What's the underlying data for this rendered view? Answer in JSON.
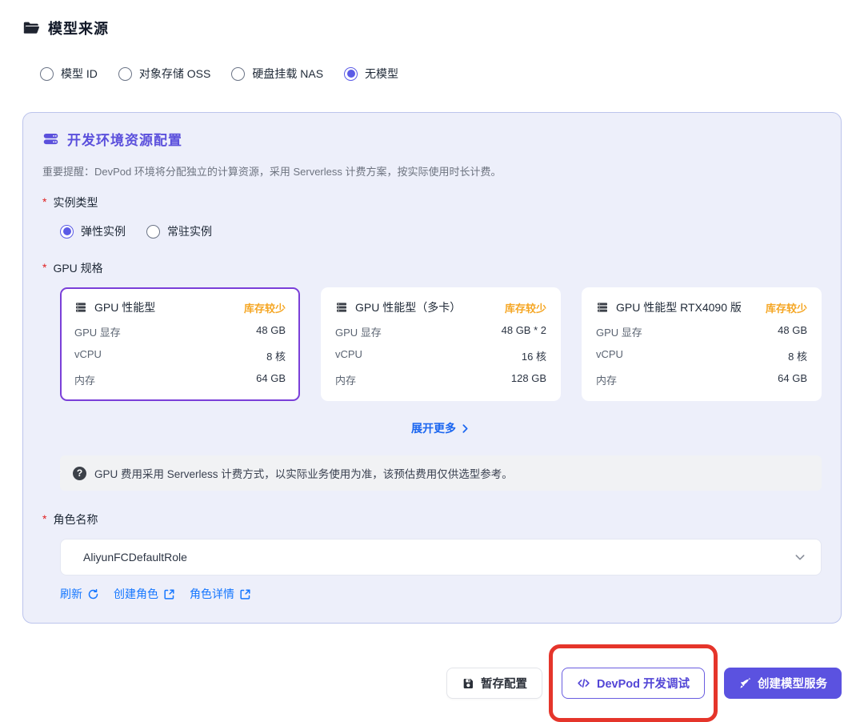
{
  "colors": {
    "primary_purple": "#5b52e0",
    "selected_border_purple": "#7a3fd8",
    "link_blue": "#1677ff",
    "expand_blue": "#1b66f0",
    "badge_orange": "#f5a623",
    "annotation_red": "#e5352b",
    "panel_bg": "#edeffa",
    "required_red": "#e02020"
  },
  "header": {
    "title": "模型来源"
  },
  "model_source": {
    "options": [
      {
        "label": "模型 ID",
        "selected": false
      },
      {
        "label": "对象存储 OSS",
        "selected": false
      },
      {
        "label": "硬盘挂载 NAS",
        "selected": false
      },
      {
        "label": "无模型",
        "selected": true
      }
    ]
  },
  "panel": {
    "title": "开发环境资源配置",
    "notice": "重要提醒：DevPod 环境将分配独立的计算资源，采用 Serverless 计费方案，按实际使用时长计费。",
    "instance_type": {
      "label": "实例类型",
      "options": [
        {
          "label": "弹性实例",
          "selected": true
        },
        {
          "label": "常驻实例",
          "selected": false
        }
      ]
    },
    "gpu_spec": {
      "label": "GPU 规格",
      "cards": [
        {
          "name": "GPU 性能型",
          "badge": "库存较少",
          "selected": true,
          "specs": [
            {
              "label": "GPU 显存",
              "value": "48 GB"
            },
            {
              "label": "vCPU",
              "value": "8 核"
            },
            {
              "label": "内存",
              "value": "64 GB"
            }
          ]
        },
        {
          "name": "GPU 性能型（多卡）",
          "badge": "库存较少",
          "selected": false,
          "specs": [
            {
              "label": "GPU 显存",
              "value": "48 GB * 2"
            },
            {
              "label": "vCPU",
              "value": "16 核"
            },
            {
              "label": "内存",
              "value": "128 GB"
            }
          ]
        },
        {
          "name": "GPU 性能型 RTX4090 版",
          "badge": "库存较少",
          "selected": false,
          "specs": [
            {
              "label": "GPU 显存",
              "value": "48 GB"
            },
            {
              "label": "vCPU",
              "value": "8 核"
            },
            {
              "label": "内存",
              "value": "64 GB"
            }
          ]
        }
      ],
      "expand_more": "展开更多",
      "fee_tip": "GPU 费用采用 Serverless 计费方式，以实际业务使用为准，该预估费用仅供选型参考。"
    },
    "role": {
      "label": "角色名称",
      "value": "AliyunFCDefaultRole",
      "links": [
        {
          "label": "刷新",
          "icon": "refresh-icon"
        },
        {
          "label": "创建角色",
          "icon": "external-link-icon"
        },
        {
          "label": "角色详情",
          "icon": "external-link-icon"
        }
      ]
    },
    "required_marker": "*"
  },
  "footer": {
    "save_draft_label": "暂存配置",
    "devpod_label": "DevPod 开发调试",
    "create_service_label": "创建模型服务"
  }
}
